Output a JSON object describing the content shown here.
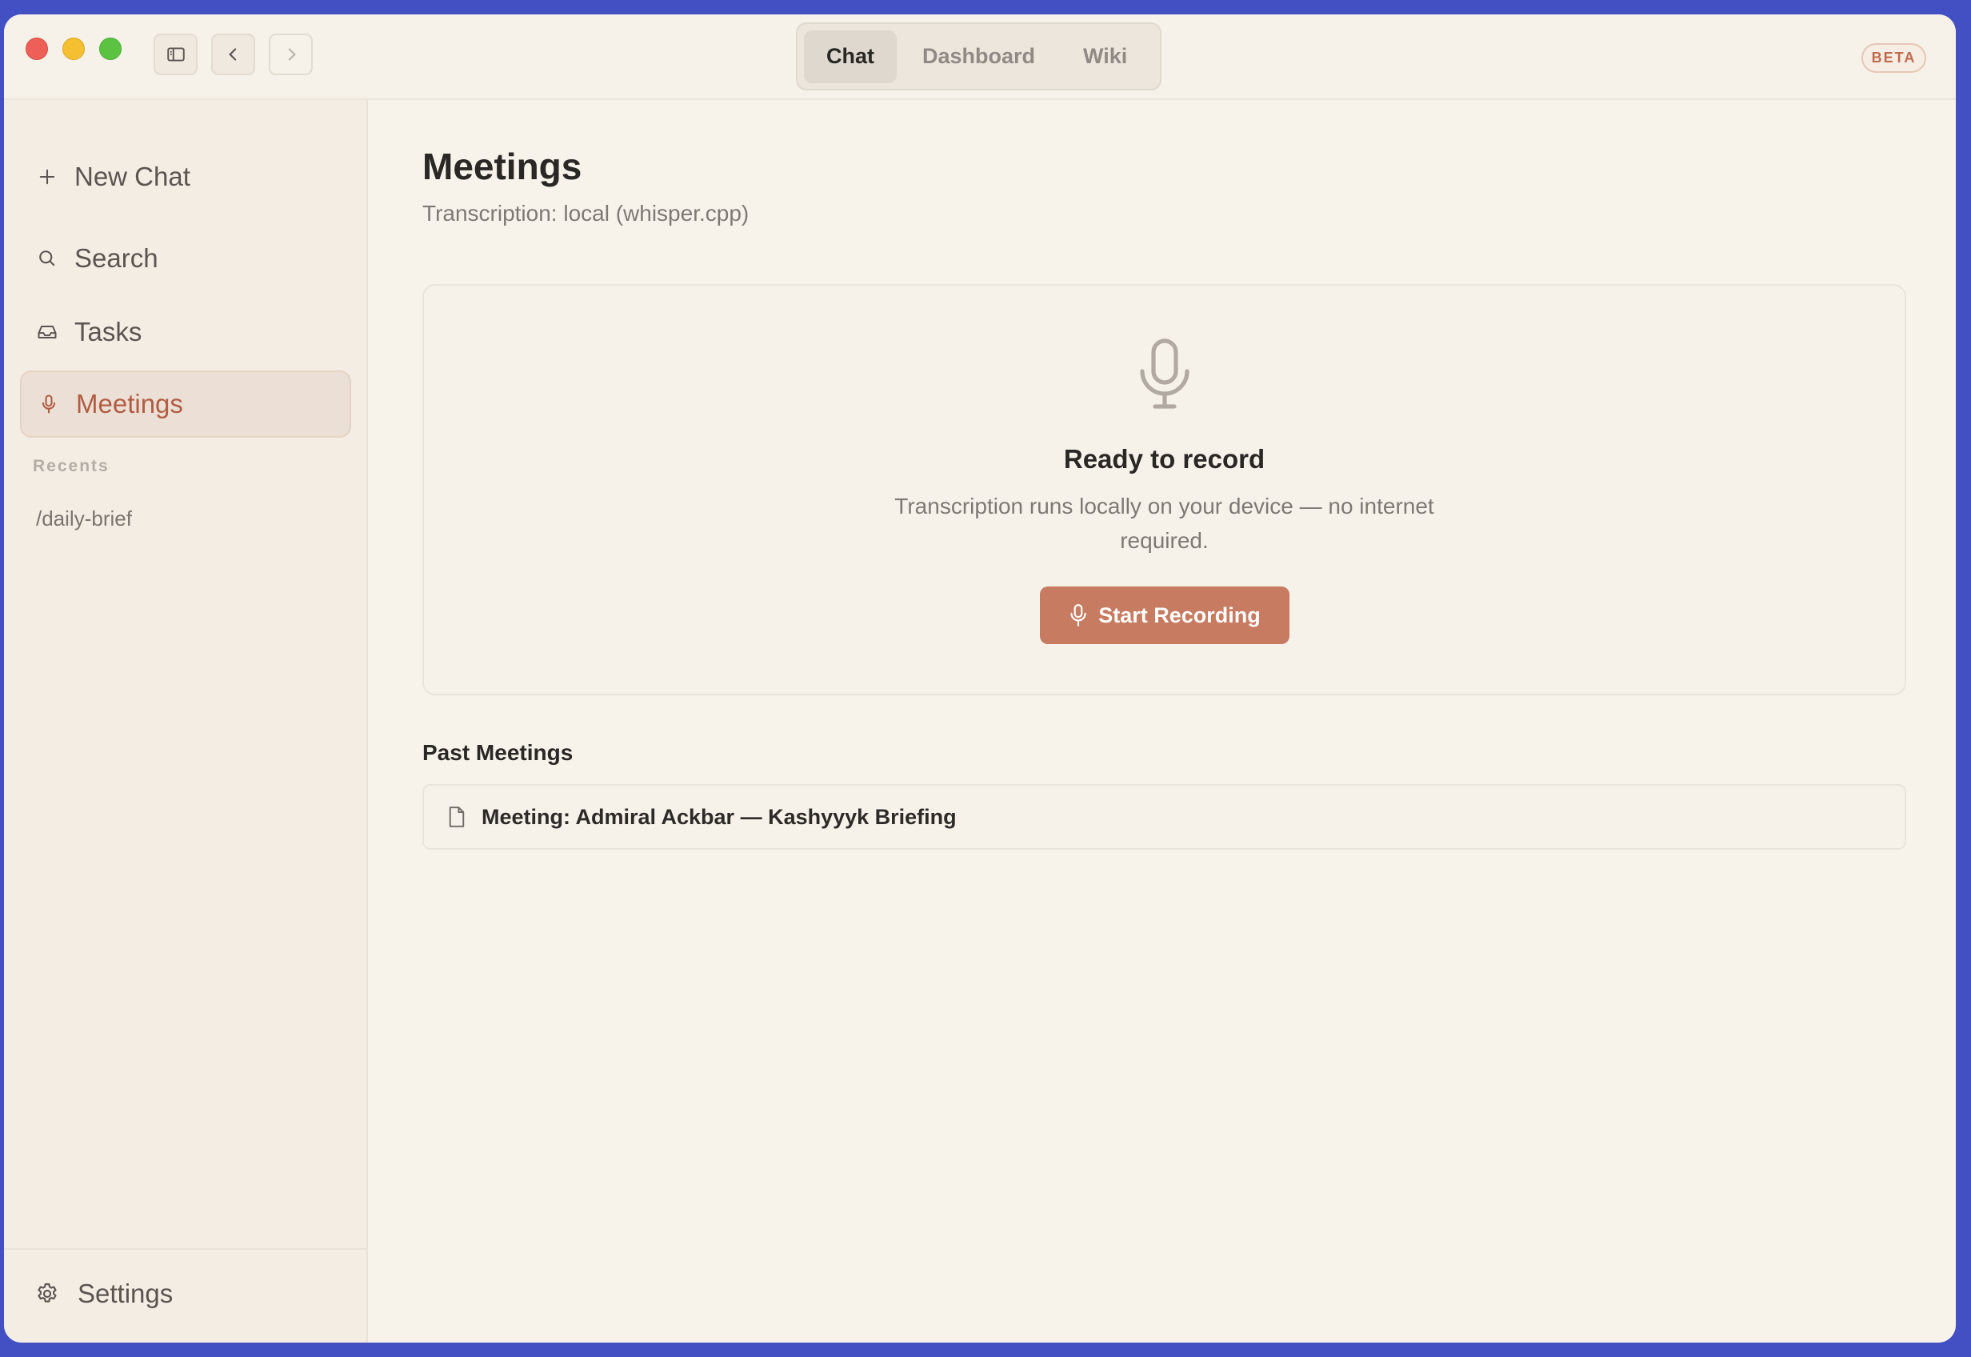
{
  "titlebar": {
    "tabs": [
      {
        "label": "Chat",
        "active": true
      },
      {
        "label": "Dashboard",
        "active": false
      },
      {
        "label": "Wiki",
        "active": false
      }
    ],
    "badge": "BETA"
  },
  "sidebar": {
    "items": [
      {
        "label": "New Chat",
        "icon": "plus-icon"
      },
      {
        "label": "Search",
        "icon": "search-icon"
      },
      {
        "label": "Tasks",
        "icon": "inbox-icon"
      },
      {
        "label": "Meetings",
        "icon": "microphone-icon",
        "active": true
      }
    ],
    "recents_label": "Recents",
    "recents": [
      "/daily-brief"
    ],
    "settings_label": "Settings"
  },
  "main": {
    "title": "Meetings",
    "subtitle": "Transcription: local (whisper.cpp)",
    "record_card": {
      "title": "Ready to record",
      "description": "Transcription runs locally on your device — no internet required.",
      "button_label": "Start Recording"
    },
    "past_heading": "Past Meetings",
    "past_meetings": [
      "Meeting: Admiral Ackbar — Kashyyyk Briefing"
    ]
  },
  "colors": {
    "accent": "#c77b60",
    "active_nav_text": "#b15d43",
    "background": "#f7f2ea",
    "desktop": "#4250c4"
  }
}
